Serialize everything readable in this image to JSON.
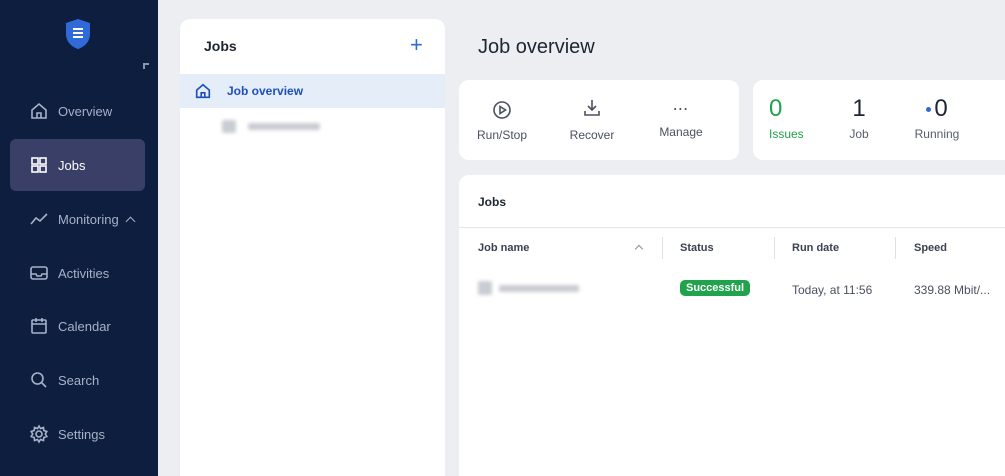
{
  "sidebar": {
    "items": [
      {
        "label": "Overview",
        "icon": "home-icon"
      },
      {
        "label": "Jobs",
        "icon": "grid-icon"
      },
      {
        "label": "Monitoring",
        "icon": "chart-line-icon"
      },
      {
        "label": "Activities",
        "icon": "inbox-icon"
      },
      {
        "label": "Calendar",
        "icon": "calendar-icon"
      },
      {
        "label": "Search",
        "icon": "search-icon"
      },
      {
        "label": "Settings",
        "icon": "gear-icon"
      }
    ]
  },
  "jobs_panel": {
    "title": "Jobs",
    "add_label": "+",
    "active_item": "Job overview"
  },
  "main": {
    "title": "Job overview",
    "toolbar": {
      "run_stop": "Run/Stop",
      "recover": "Recover",
      "manage": "Manage"
    },
    "stats": {
      "issues_value": "0",
      "issues_label": "Issues",
      "job_value": "1",
      "job_label": "Job",
      "running_value": "0",
      "running_label": "Running"
    },
    "jobs_table": {
      "title": "Jobs",
      "columns": [
        "Job name",
        "Status",
        "Run date",
        "Speed"
      ],
      "rows": [
        {
          "status": "Successful",
          "run_date": "Today, at 11:56",
          "speed": "339.88 Mbit/..."
        }
      ]
    }
  },
  "colors": {
    "sidebar_bg": "#0e1e3f",
    "accent": "#2f6ad8",
    "success": "#21a24d",
    "issues_green": "#21a24d"
  }
}
